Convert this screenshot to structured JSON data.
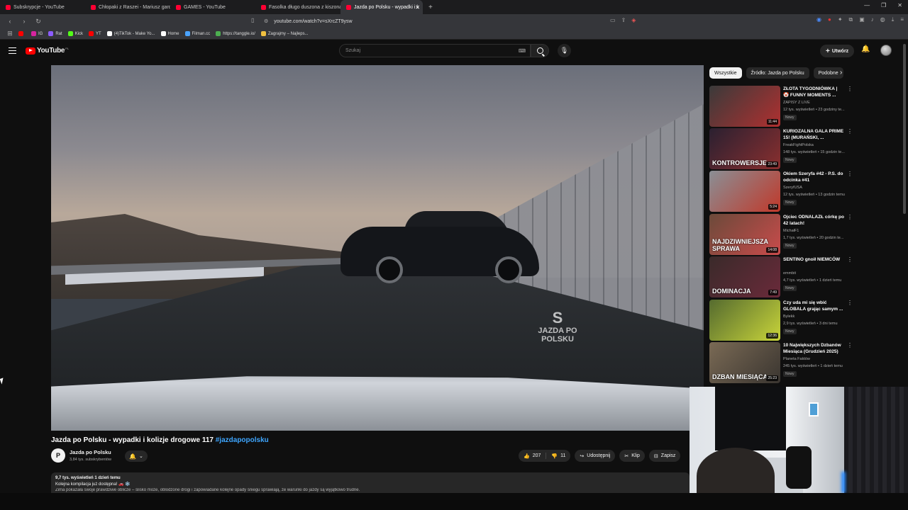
{
  "browser": {
    "tabs": [
      {
        "label": "Subskrypcje - YouTube",
        "active": false
      },
      {
        "label": "Chłopaki z Raszei - Mariusz gardzi p",
        "active": false
      },
      {
        "label": "GAMES - YouTube",
        "active": false
      },
      {
        "label": "Fasolka długo duszona z kiszoną kap",
        "active": false
      },
      {
        "label": "Jazda po Polsku - wypadki i k",
        "active": true
      }
    ],
    "tab_close": "✕",
    "new_tab": "+",
    "url": "youtube.com/watch?v=sXrcZT9ysw",
    "bookmarks": [
      {
        "label": "",
        "color": "#ff0000"
      },
      {
        "label": "IG",
        "color": "#d6249f"
      },
      {
        "label": "Rat",
        "color": "#8c5cff"
      },
      {
        "label": "Kick",
        "color": "#53fc18"
      },
      {
        "label": "YT",
        "color": "#ff0000"
      },
      {
        "label": "(4)TikTok - Make Yo...",
        "color": "#ffffff"
      },
      {
        "label": "Home",
        "color": "#ffffff"
      },
      {
        "label": "Filman.cc",
        "color": "#4aa3ff"
      },
      {
        "label": "https://tanggle.io/",
        "color": "#4caf50"
      },
      {
        "label": "Zagrajmy – Najleps...",
        "color": "#f0c040"
      }
    ]
  },
  "header": {
    "logo_text": "YouTube",
    "country": "PL",
    "search_placeholder": "Szukaj",
    "create_label": "Utwórz"
  },
  "video": {
    "watermark_line1": "S",
    "watermark_line2": "JAZDA PO",
    "watermark_line3": "POLSKU"
  },
  "chips": [
    "Wszystkie",
    "Źródło: Jazda po Polsku",
    "Podobne"
  ],
  "recommendations": [
    {
      "title": "ZŁOTA TYGODNIÓWKA | 🤡 FUNNY MOMENTS ...",
      "channel": "ZAPISY Z LIVE",
      "meta": "12 tys. wyświetleń • 23 godziny te...",
      "badge": "Nowy",
      "duration": "11:44",
      "thumb_label": "",
      "color1": "#3a3a3a",
      "color2": "#b03030"
    },
    {
      "title": "KURIOZALNA GALA PRIME 15! (MURAŃSKI, ...",
      "channel": "FreakFightPolska",
      "meta": "148 tys. wyświetleń • 15 godzin te...",
      "badge": "Nowy",
      "duration": "23:49",
      "thumb_label": "KONTROWERSJE",
      "color1": "#2a2030",
      "color2": "#8a2f2f"
    },
    {
      "title": "Okiem Szeryfa #42 - P.S. do odcinka #41",
      "channel": "SzeryfUSA",
      "meta": "12 tys. wyświetleń • 13 godzin temu",
      "badge": "Nowy",
      "duration": "5:24",
      "thumb_label": "",
      "color1": "#8a8f95",
      "color2": "#c0392b"
    },
    {
      "title": "Ojciec ODNALAZŁ córkę po 42 latach!",
      "channel": "MichałF1",
      "meta": "1,7 tys. wyświetleń • 20 godzin te...",
      "badge": "Nowy",
      "duration": "14:08",
      "thumb_label": "NAJDZIWNIEJSZA SPRAWA",
      "color1": "#6b4a3a",
      "color2": "#c94b4b"
    },
    {
      "title": "SENTINO gnoił NIEMCÓW",
      "channel": "emmbit",
      "meta": "4,7 tys. wyświetleń • 1 dzień temu",
      "badge": "Nowy",
      "duration": "7:49",
      "thumb_label": "DOMINACJA",
      "color1": "#3a2a2a",
      "color2": "#6a2a3a"
    },
    {
      "title": "Czy uda mi się wbić GLOBALA grając samym ...",
      "channel": "Bylekk",
      "meta": "2,9 tys. wyświetleń • 3 dni temu",
      "badge": "Nowy",
      "duration": "12:36",
      "thumb_label": "",
      "color1": "#556b2f",
      "color2": "#c8d43a"
    },
    {
      "title": "10 Największych Dzbanów Miesiąca (Grudzień 2025)",
      "channel": "Planeta Faktów",
      "meta": "245 tys. wyświetleń • 1 dzień temu",
      "badge": "Nowy",
      "duration": "25:23",
      "thumb_label": "DZBAN MIESIĄCA",
      "color1": "#7a6a55",
      "color2": "#3a3530"
    }
  ],
  "watch": {
    "title": "Jazda po Polsku - wypadki i kolizje drogowe 117",
    "hashtag": "#jazdapopolsku",
    "channel_name": "Jazda po Polsku",
    "channel_initial": "P",
    "subscribers": "3,84 tys. subskrybentów",
    "likes": "207",
    "dislikes": "11",
    "share_label": "Udostępnij",
    "clip_label": "Klip",
    "save_label": "Zapisz",
    "views_date": "9,7 tys. wyświetleń  1 dzień temu",
    "desc_line1": "Kolejna kompilacja już dostępna! 🚗 ❄️",
    "desc_line2": "Zima pokazała swoje prawdziwe oblicze – ślisko może, oblodzone drogi i zapowiadane kolejne opady śniegu sprawiają, że warunki do jazdy są wyjątkowo trudne."
  }
}
